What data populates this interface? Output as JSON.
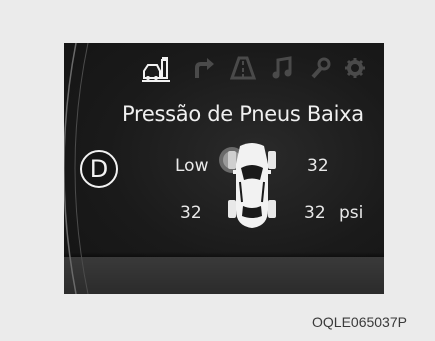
{
  "gear": "D",
  "warning_title": "Pressão de Pneus Baixa",
  "tires": {
    "front_left": "Low",
    "front_right": "32",
    "rear_left": "32",
    "rear_right": "32"
  },
  "unit": "psi",
  "menu_icons": [
    "car-fuel-icon",
    "turn-arrow-icon",
    "road-icon",
    "music-note-icon",
    "wrench-icon",
    "settings-gear-icon"
  ],
  "caption": "OQLE065037P",
  "colors": {
    "screen_bg": "#181818",
    "text": "#f0f0f0",
    "icon_inactive": "#4a4a4a",
    "warning_tire": "#8a8a8a"
  }
}
